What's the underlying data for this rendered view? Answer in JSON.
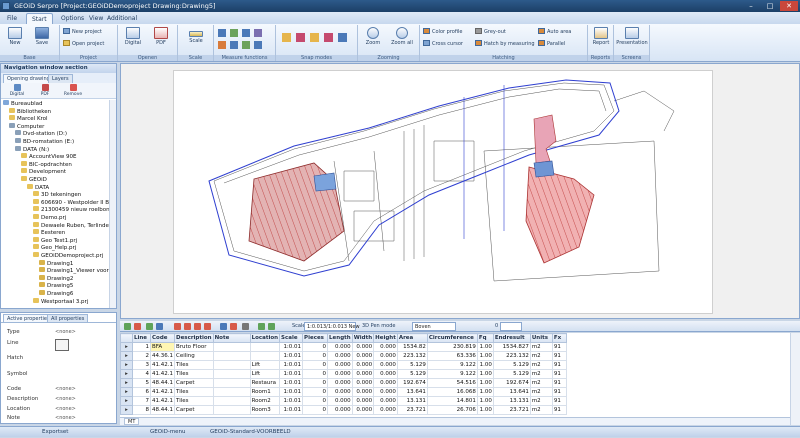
{
  "window": {
    "title": "GEOiD Serpro [Project:GEOiDDemoproject Drawing:Drawing5]"
  },
  "menu": {
    "tabs": [
      "File",
      "Start",
      "Options",
      "View",
      "Additional"
    ]
  },
  "ribbon": {
    "new": "New",
    "save": "Save",
    "new_project": "New project",
    "open_project": "Open project",
    "digital": "Digital",
    "pdf": "PDF",
    "scale": "Scale",
    "zoom": "Zoom",
    "zoom_all": "Zoom all",
    "color_profile": "Color profile",
    "cross_cursor": "Cross cursor",
    "grey_out": "Grey-out",
    "hatch_by_measuring": "Hatch by measuring",
    "auto_area": "Auto area",
    "parallel": "Parallel",
    "report": "Report",
    "presentation": "Presentation",
    "groups": [
      "Base",
      "Project",
      "Openen",
      "Scale",
      "Measure functions",
      "Snap modes",
      "Zooming",
      "Hatching",
      "Reports",
      "Screens"
    ]
  },
  "nav": {
    "header": "Navigation window section",
    "tabs": [
      "Opening drawings",
      "Layers"
    ],
    "icons": [
      "Digital",
      "PDF",
      "Remove"
    ],
    "tree": [
      {
        "label": "Bureaublad",
        "level": 0,
        "color": "#7fa7d9"
      },
      {
        "label": "Bibliotheken",
        "level": 1,
        "color": "#e7c35a"
      },
      {
        "label": "Marcel Krol",
        "level": 1,
        "color": "#e7c35a"
      },
      {
        "label": "Computer",
        "level": 1,
        "color": "#8aa0b8"
      },
      {
        "label": "Dvd-station (D:)",
        "level": 2,
        "color": "#8aa0b8"
      },
      {
        "label": "BD-romstation (E:)",
        "level": 2,
        "color": "#8aa0b8"
      },
      {
        "label": "DATA (N:)",
        "level": 2,
        "color": "#8aa0b8"
      },
      {
        "label": "AccountView 90E",
        "level": 3,
        "color": "#e7c35a"
      },
      {
        "label": "BIC-opdrachten",
        "level": 3,
        "color": "#e7c35a"
      },
      {
        "label": "Development",
        "level": 3,
        "color": "#e7c35a"
      },
      {
        "label": "GEOiD",
        "level": 3,
        "color": "#e7c35a"
      },
      {
        "label": "DATA",
        "level": 4,
        "color": "#e7c35a"
      },
      {
        "label": "3D tekeningen",
        "level": 5,
        "color": "#e7c35a"
      },
      {
        "label": "606690 - Westpolder II Berl",
        "level": 5,
        "color": "#e7c35a"
      },
      {
        "label": "21300459 nieuw roelbond",
        "level": 5,
        "color": "#e7c35a"
      },
      {
        "label": "Demo.prj",
        "level": 5,
        "color": "#e7c35a"
      },
      {
        "label": "Dewaele Ruben, Terlinden",
        "level": 5,
        "color": "#e7c35a"
      },
      {
        "label": "Eesteren",
        "level": 5,
        "color": "#e7c35a"
      },
      {
        "label": "Geo Test1.prj",
        "level": 5,
        "color": "#e7c35a"
      },
      {
        "label": "Geo_Help.prj",
        "level": 5,
        "color": "#e7c35a"
      },
      {
        "label": "GEOiDDemoproject.prj",
        "level": 5,
        "color": "#e7c35a"
      },
      {
        "label": "Drawing1",
        "level": 6,
        "color": "#d9b34a"
      },
      {
        "label": "Drawing1_Viewer voor",
        "level": 6,
        "color": "#d9b34a"
      },
      {
        "label": "Drawing2",
        "level": 6,
        "color": "#d9b34a"
      },
      {
        "label": "Drawing5",
        "level": 6,
        "color": "#d9b34a"
      },
      {
        "label": "Drawing6",
        "level": 6,
        "color": "#d9b34a"
      },
      {
        "label": "Westportaal 3.prj",
        "level": 5,
        "color": "#e7c35a"
      }
    ]
  },
  "properties": {
    "tabs": [
      "Active properties",
      "All properties"
    ],
    "rows": [
      {
        "label": "Type",
        "value": "<none>"
      },
      {
        "label": "Line",
        "value": ""
      },
      {
        "label": "Hatch",
        "value": ""
      },
      {
        "label": "Symbol",
        "value": ""
      },
      {
        "label": "Code",
        "value": "<none>"
      },
      {
        "label": "Description",
        "value": "<none>"
      },
      {
        "label": "Location",
        "value": "<none>"
      },
      {
        "label": "Note",
        "value": "<none>"
      }
    ]
  },
  "toolbar": {
    "scale_label": "Scale",
    "scale_value": "1:0.013/1:0.013 New",
    "pen_mode": "3D Pen mode",
    "view_mode": "Boven",
    "value": "0"
  },
  "table": {
    "columns": [
      "Line",
      "Code",
      "Description",
      "Note",
      "Location",
      "Scale",
      "Pieces",
      "Length",
      "Width",
      "Height",
      "Area",
      "Circumference",
      "Fq",
      "Endresult",
      "Units",
      "Fx"
    ],
    "rows": [
      [
        "1",
        "BFA",
        "Bruto Floor",
        "",
        "",
        "1:0.01",
        "0",
        "0.000",
        "0.000",
        "0.000",
        "1534.82",
        "230.819",
        "1.00",
        "1534.827",
        "m2",
        "91"
      ],
      [
        "2",
        "44.36.1",
        "Ceiling",
        "",
        "",
        "1:0.01",
        "0",
        "0.000",
        "0.000",
        "0.000",
        "223.132",
        "63.336",
        "1.00",
        "223.132",
        "m2",
        "91"
      ],
      [
        "3",
        "41.42.1",
        "Tiles",
        "",
        "Lift",
        "1:0.01",
        "0",
        "0.000",
        "0.000",
        "0.000",
        "5.129",
        "9.122",
        "1.00",
        "5.129",
        "m2",
        "91"
      ],
      [
        "4",
        "41.42.1",
        "Tiles",
        "",
        "Lift",
        "1:0.01",
        "0",
        "0.000",
        "0.000",
        "0.000",
        "5.129",
        "9.122",
        "1.00",
        "5.129",
        "m2",
        "91"
      ],
      [
        "5",
        "48.44.1",
        "Carpet",
        "",
        "Restaura",
        "1:0.01",
        "0",
        "0.000",
        "0.000",
        "0.000",
        "192.674",
        "54.516",
        "1.00",
        "192.674",
        "m2",
        "91"
      ],
      [
        "6",
        "41.42.1",
        "Tiles",
        "",
        "Room1",
        "1:0.01",
        "0",
        "0.000",
        "0.000",
        "0.000",
        "13.641",
        "16.068",
        "1.00",
        "13.641",
        "m2",
        "91"
      ],
      [
        "7",
        "41.42.1",
        "Tiles",
        "",
        "Room2",
        "1:0.01",
        "0",
        "0.000",
        "0.000",
        "0.000",
        "13.131",
        "14.801",
        "1.00",
        "13.131",
        "m2",
        "91"
      ],
      [
        "8",
        "48.44.1",
        "Carpet",
        "",
        "Room3",
        "1:0.01",
        "0",
        "0.000",
        "0.000",
        "0.000",
        "23.721",
        "26.706",
        "1.00",
        "23.721",
        "m2",
        "91"
      ]
    ],
    "sheet_tab": "MT"
  },
  "status": {
    "left": "Exportset",
    "middle1": "GEOiD-menu",
    "middle2": "GEOiD-Standard-VOORBEELD"
  }
}
